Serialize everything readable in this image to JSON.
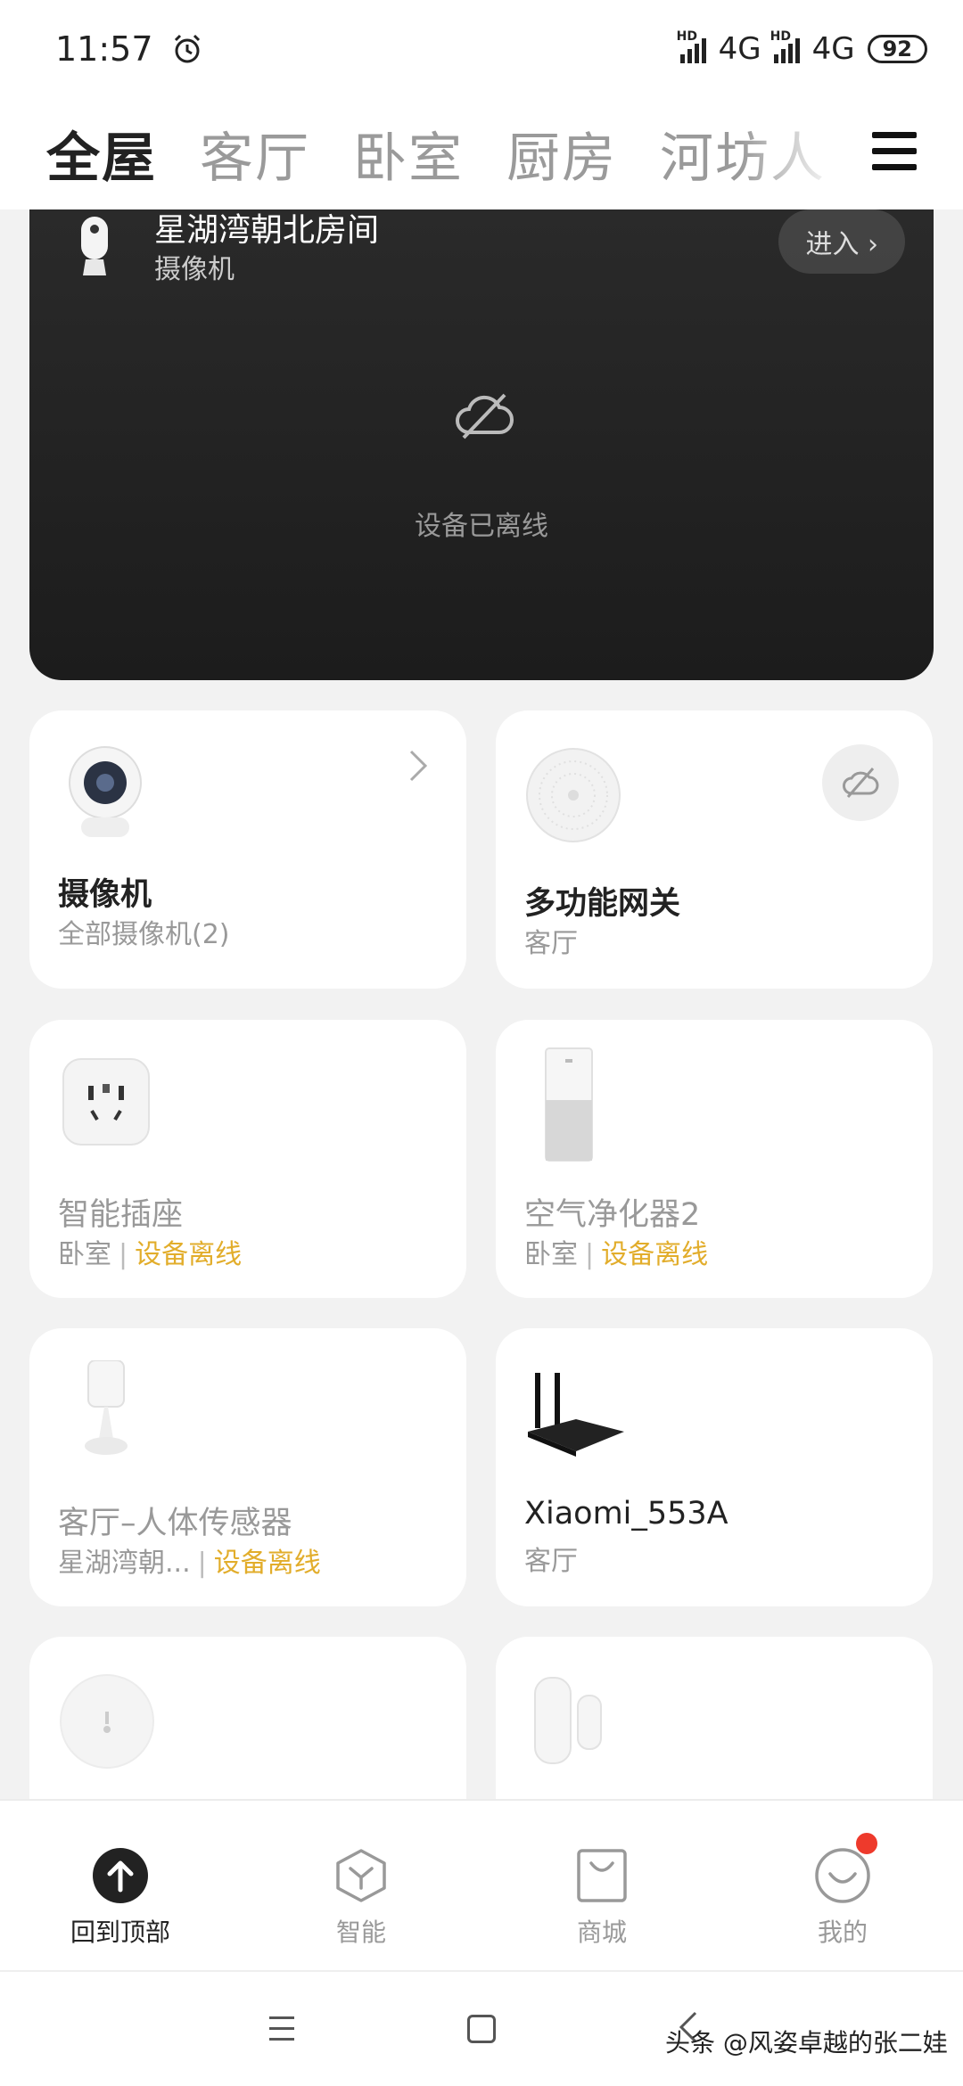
{
  "status_bar": {
    "time": "11:57",
    "network1": "4G",
    "network2": "4G",
    "hd_label": "HD",
    "battery": "92"
  },
  "tabs": [
    "全屋",
    "客厅",
    "卧室",
    "厨房",
    "河坊人"
  ],
  "camera_card": {
    "name": "星湖湾朝北房间",
    "type": "摄像机",
    "enter": "进入 ›",
    "offline_text": "设备已离线"
  },
  "devices": [
    {
      "name": "摄像机",
      "room": "全部摄像机(2)",
      "status": ""
    },
    {
      "name": "多功能网关",
      "room": "客厅",
      "status": ""
    },
    {
      "name": "智能插座",
      "room": "卧室",
      "status": "设备离线"
    },
    {
      "name": "空气净化器2",
      "room": "卧室",
      "status": "设备离线"
    },
    {
      "name": "客厅–人体传感器",
      "room": "星湖湾朝...",
      "status": "设备离线"
    },
    {
      "name": "Xiaomi_553A",
      "room": "客厅",
      "status": ""
    }
  ],
  "separator": "|",
  "bottom_nav": [
    {
      "label": "回到顶部",
      "icon": "arrow-up-icon"
    },
    {
      "label": "智能",
      "icon": "cube-icon"
    },
    {
      "label": "商城",
      "icon": "shopping-bag-icon"
    },
    {
      "label": "我的",
      "icon": "smile-icon"
    }
  ],
  "watermark": "头条 @风姿卓越的张二娃",
  "colors": {
    "warning": "#e2ad2b",
    "notification_dot": "#ee3a2c",
    "card_dark": "#222222"
  }
}
